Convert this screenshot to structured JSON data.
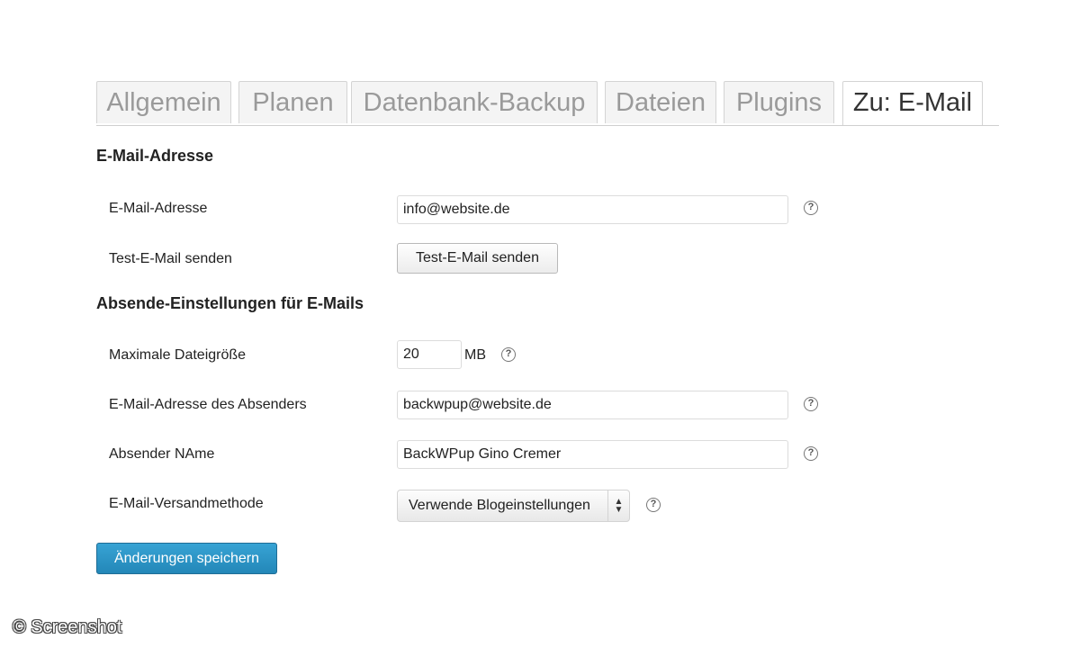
{
  "tabs": [
    {
      "label": "Allgemein",
      "active": false
    },
    {
      "label": "Planen",
      "active": false
    },
    {
      "label": "Datenbank-Backup",
      "active": false
    },
    {
      "label": "Dateien",
      "active": false
    },
    {
      "label": "Plugins",
      "active": false
    },
    {
      "label": "Zu: E-Mail",
      "active": true
    }
  ],
  "section_email": {
    "title": "E-Mail-Adresse",
    "address_label": "E-Mail-Adresse",
    "address_value": "info@website.de",
    "test_label": "Test-E-Mail senden",
    "test_button": "Test-E-Mail senden"
  },
  "section_sending": {
    "title": "Absende-Einstellungen für E-Mails",
    "max_size_label": "Maximale Dateigröße",
    "max_size_value": "20",
    "max_size_unit": "MB",
    "sender_address_label": "E-Mail-Adresse des Absenders",
    "sender_address_value": "backwpup@website.de",
    "sender_name_label": "Absender NAme",
    "sender_name_value": "BackWPup Gino Cremer",
    "method_label": "E-Mail-Versandmethode",
    "method_value": "Verwende Blogeinstellungen"
  },
  "save_button": "Änderungen speichern",
  "help_glyph": "?",
  "watermark": "© Screenshot",
  "colors": {
    "primary_button": "#2a8fc2",
    "tab_active_text": "#333333",
    "tab_inactive_text": "#9a9a9a"
  }
}
